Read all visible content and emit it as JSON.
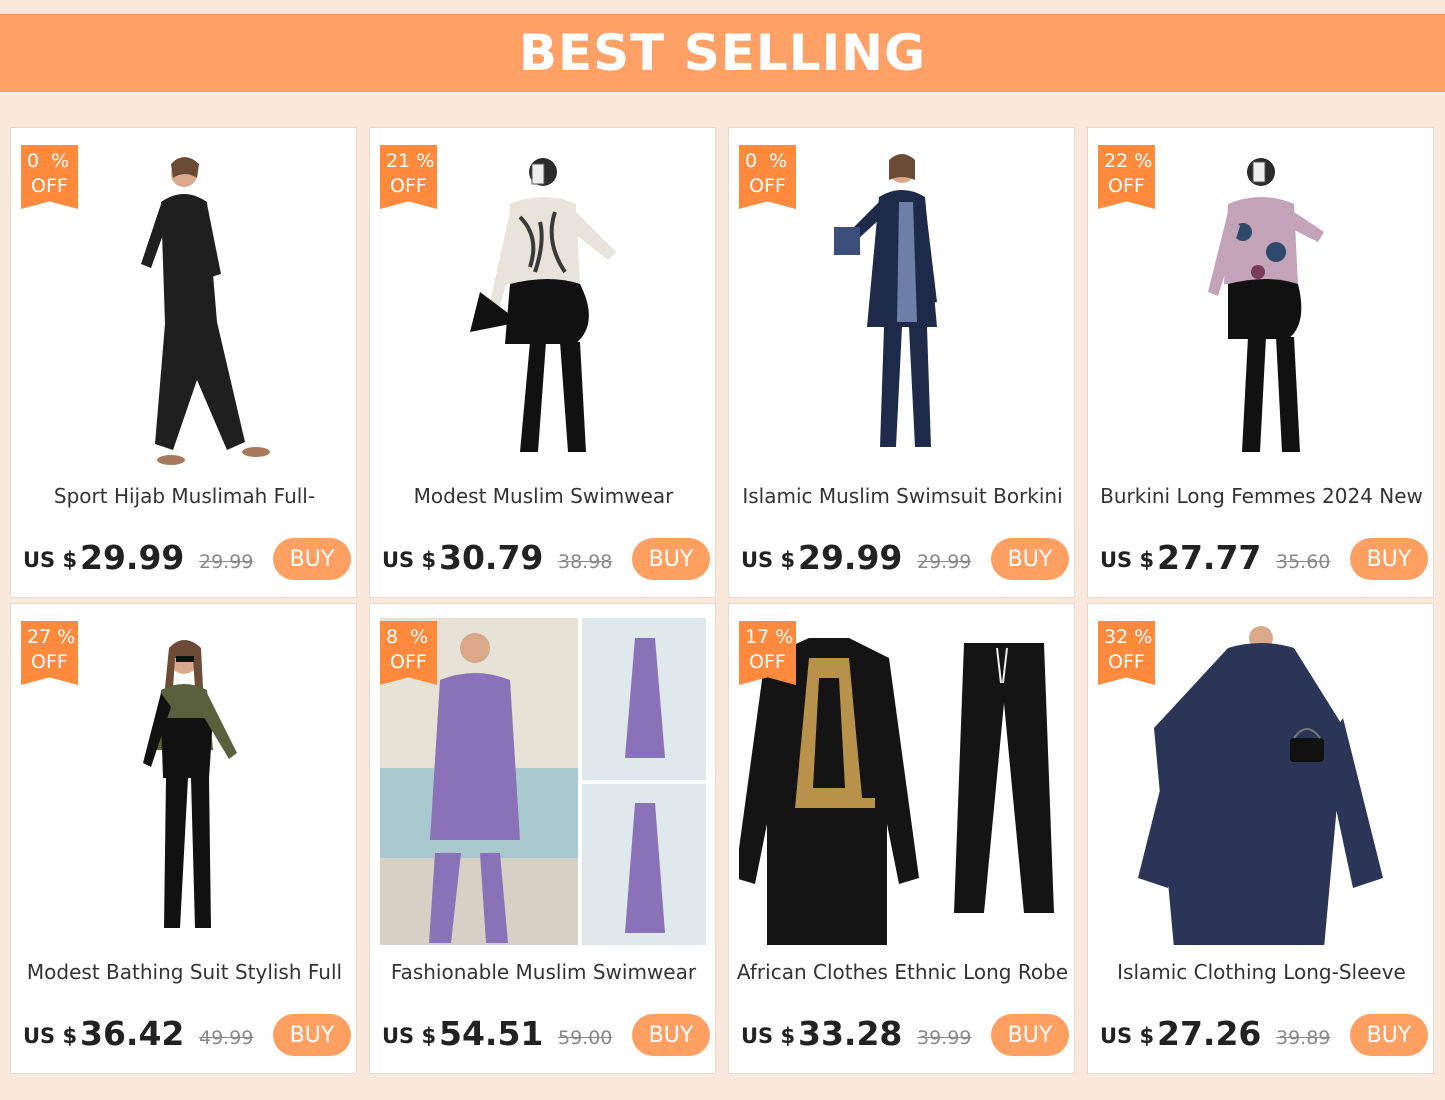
{
  "banner": {
    "title": "BEST SELLING"
  },
  "colors": {
    "banner": "#ffa066",
    "badge": "#ff8a3d",
    "buy": "#ff9f62",
    "page_bg": "#fbe8dc"
  },
  "products": [
    {
      "discount": "0  %",
      "off": "OFF",
      "title": "Sport Hijab Muslimah Full-",
      "currency": "US $",
      "price": "29.99",
      "old_price": "29.99",
      "buy": "BUY",
      "image": "woman-black-long-dress-image"
    },
    {
      "discount": "21 %",
      "off": "OFF",
      "title": "Modest Muslim Swimwear",
      "currency": "US $",
      "price": "30.79",
      "old_price": "38.98",
      "buy": "BUY",
      "image": "woman-leaf-print-swimsuit-image"
    },
    {
      "discount": "0  %",
      "off": "OFF",
      "title": "Islamic Muslim Swimsuit Borkini",
      "currency": "US $",
      "price": "29.99",
      "old_price": "29.99",
      "buy": "BUY",
      "image": "woman-navy-floral-burkini-image"
    },
    {
      "discount": "22 %",
      "off": "OFF",
      "title": "Burkini Long Femmes 2024 New",
      "currency": "US $",
      "price": "27.77",
      "old_price": "35.60",
      "buy": "BUY",
      "image": "woman-floral-top-black-legging-image"
    },
    {
      "discount": "27 %",
      "off": "OFF",
      "title": "Modest Bathing Suit Stylish Full",
      "currency": "US $",
      "price": "36.42",
      "old_price": "49.99",
      "buy": "BUY",
      "image": "woman-olive-black-bodysuit-image"
    },
    {
      "discount": "8  %",
      "off": "OFF",
      "title": "Fashionable Muslim Swimwear",
      "currency": "US $",
      "price": "54.51",
      "old_price": "59.00",
      "buy": "BUY",
      "image": "woman-purple-two-piece-image"
    },
    {
      "discount": "17 %",
      "off": "OFF",
      "title": "African Clothes Ethnic Long Robe",
      "currency": "US $",
      "price": "33.28",
      "old_price": "39.99",
      "buy": "BUY",
      "image": "black-gold-robe-and-pants-image"
    },
    {
      "discount": "32 %",
      "off": "OFF",
      "title": "Islamic Clothing Long-Sleeve",
      "currency": "US $",
      "price": "27.26",
      "old_price": "39.89",
      "buy": "BUY",
      "image": "woman-navy-abaya-image"
    }
  ]
}
